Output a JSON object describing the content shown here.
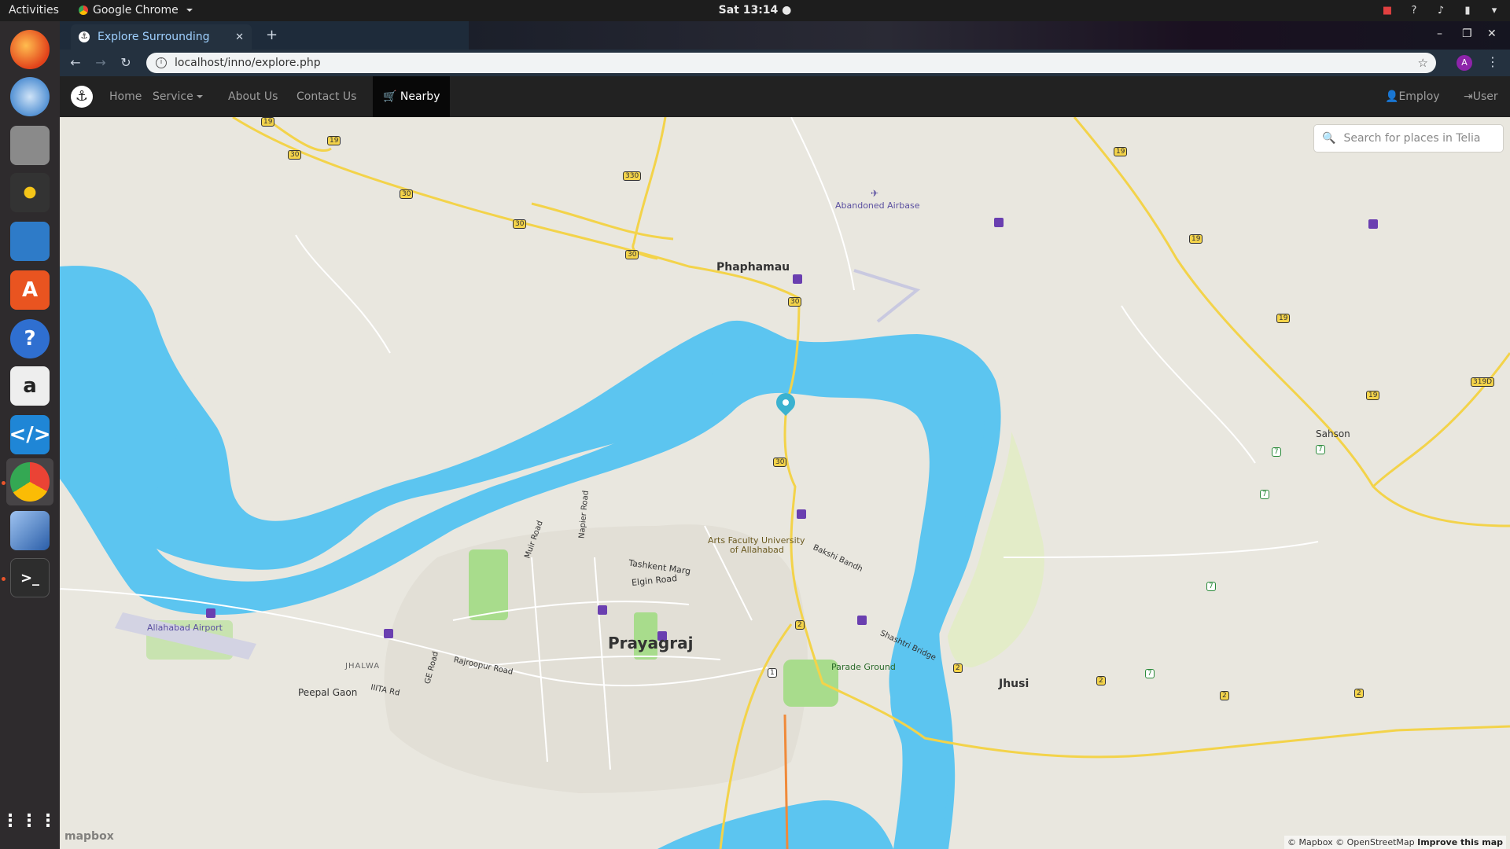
{
  "os": {
    "activities": "Activities",
    "app_name": "Google Chrome",
    "clock": "Sat 13:14"
  },
  "browser": {
    "tab_title": "Explore Surrounding",
    "url": "localhost/inno/explore.php",
    "profile_initial": "A"
  },
  "navbar": {
    "items": [
      "Home",
      "Service",
      "About Us",
      "Contact Us",
      "Nearby"
    ],
    "active": "Nearby",
    "right": [
      "Employ",
      "User"
    ]
  },
  "map": {
    "search_placeholder": "Search for places in Telia",
    "places": {
      "phaphamau": "Phaphamau",
      "airbase": "Abandoned Airbase",
      "prayagraj": "Prayagraj",
      "jhusi": "Jhusi",
      "sahson": "Sahson",
      "airport": "Allahabad Airport",
      "arts": "Arts Faculty University",
      "arts2": "of Allahabad",
      "parade": "Parade Ground",
      "tashkent": "Tashkent Marg",
      "elgin": "Elgin Road",
      "bakshi": "Bakshi Bandh",
      "shastri": "Shashtri Bridge",
      "jhalwa": "JHALWA",
      "peepal": "Peepal Gaon",
      "iiit": "IIITA Rd",
      "rajroopur": "Rajroopur Road",
      "ge": "GE Road",
      "muir": "Muir Road",
      "napier": "Napier Road"
    },
    "shields": [
      "19",
      "30",
      "330",
      "2",
      "1",
      "7",
      "319D"
    ],
    "attribution": "© Mapbox © OpenStreetMap",
    "improve": "Improve this map",
    "logo": "mapbox"
  },
  "colors": {
    "water": "#5cc5f0",
    "land": "#e9e7df",
    "highway": "#f3d34a",
    "park": "#a8dc8c",
    "marker": "#3bb2d0"
  }
}
